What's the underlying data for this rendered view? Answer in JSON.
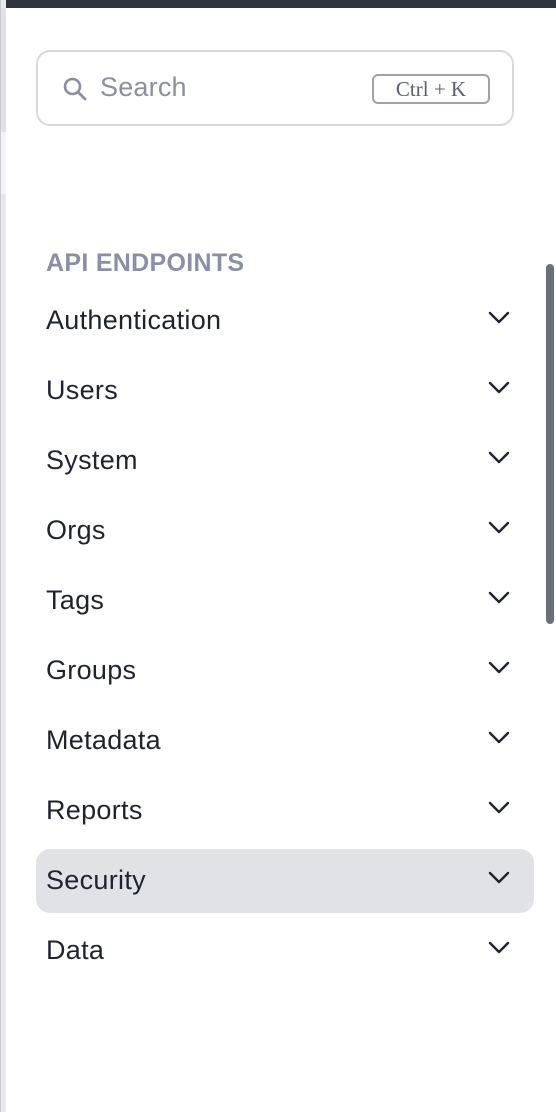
{
  "search": {
    "placeholder": "Search",
    "shortcut": "Ctrl + K"
  },
  "section": {
    "title": "API ENDPOINTS"
  },
  "nav": {
    "items": [
      {
        "label": "Authentication",
        "active": false
      },
      {
        "label": "Users",
        "active": false
      },
      {
        "label": "System",
        "active": false
      },
      {
        "label": "Orgs",
        "active": false
      },
      {
        "label": "Tags",
        "active": false
      },
      {
        "label": "Groups",
        "active": false
      },
      {
        "label": "Metadata",
        "active": false
      },
      {
        "label": "Reports",
        "active": false
      },
      {
        "label": "Security",
        "active": true
      },
      {
        "label": "Data",
        "active": false
      }
    ]
  },
  "colors": {
    "accent_active_bg": "#e1e2e6",
    "section_title": "#8a8fa6",
    "text": "#1f2330"
  },
  "icons": {
    "search": "search-icon",
    "chevron": "chevron-down-icon"
  }
}
